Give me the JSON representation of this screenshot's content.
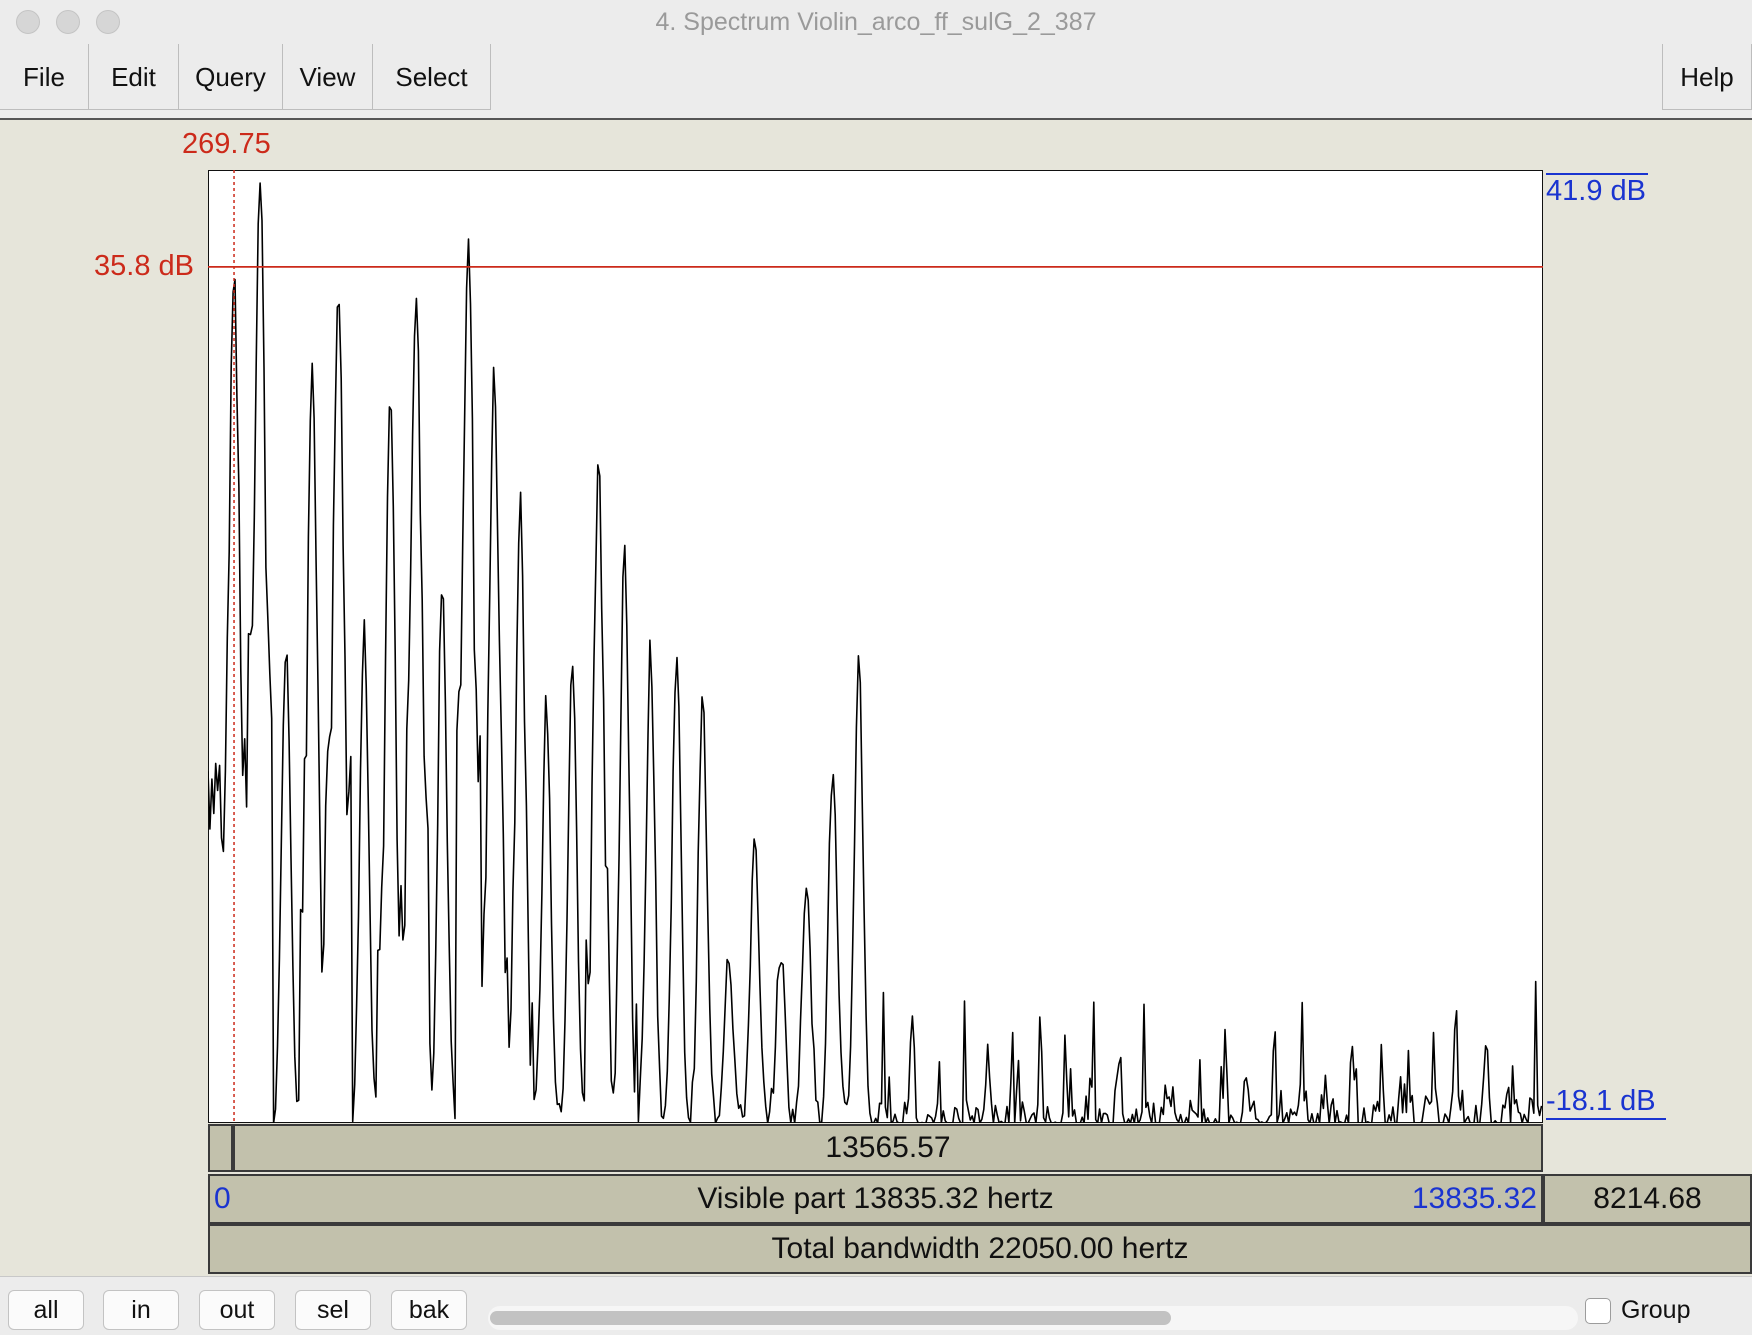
{
  "window": {
    "title": "4. Spectrum Violin_arco_ff_sulG_2_387",
    "traffic_lights": [
      "close",
      "minimize",
      "zoom"
    ]
  },
  "menu": {
    "items": [
      "File",
      "Edit",
      "Query",
      "View",
      "Select"
    ],
    "help": "Help"
  },
  "spectrum": {
    "cursor_frequency": "269.75",
    "cursor_db_label": "35.8 dB",
    "ymax_label": "41.9 dB",
    "ymin_label": "-18.1 dB",
    "xmin_hz": 0,
    "xmax_hz": 13835.32,
    "ymin_db": -18.1,
    "ymax_db": 41.9,
    "cursor_hz": 269.75,
    "cursor_db": 35.8,
    "fundamental_hz": 269.75,
    "harmonic_peaks_db": [
      35.8,
      41.9,
      12.5,
      29.0,
      34.7,
      12.8,
      27.7,
      34.5,
      16.6,
      37.2,
      29.2,
      21.7,
      8.2,
      10.7,
      24.1,
      17.8,
      11.8,
      11.7,
      8.5,
      -7.2,
      -0.7,
      -7.2,
      -2.5,
      4.2,
      11.0
    ],
    "colors": {
      "cursor": "#cc2a1a",
      "range_labels": "#1a34d0",
      "trace": "#000000",
      "bar": "#c2c1ac"
    }
  },
  "bars": {
    "window_length": "13565.57",
    "visible_part": "Visible part 13835.32 hertz",
    "visible_start": "0",
    "visible_end": "13835.32",
    "right_remaining": "8214.68",
    "total_bandwidth": "Total bandwidth 22050.00 hertz"
  },
  "bottom": {
    "buttons": [
      "all",
      "in",
      "out",
      "sel",
      "bak"
    ],
    "group_label": "Group",
    "scroll_fraction": 0.627
  }
}
